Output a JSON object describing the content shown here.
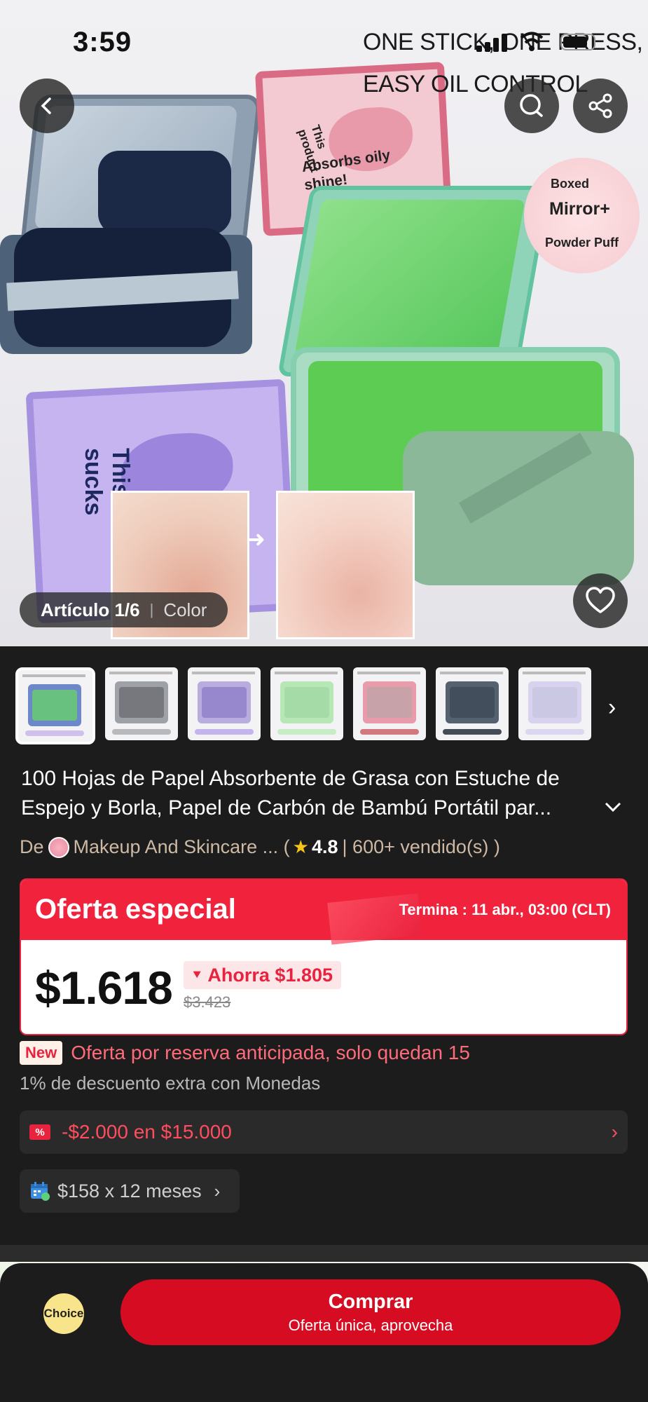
{
  "status_bar": {
    "time": "3:59"
  },
  "hero": {
    "banner_line1": "ONE STICK, ONE PRESS,",
    "banner_line2": "EASY OIL CONTROL",
    "pink_box_text": "Absorbs oily shine!",
    "pink_box_small": "This product",
    "purple_box_text": "This stuff sucks",
    "badge_line1": "Boxed",
    "badge_line2": "Mirror+",
    "badge_line3": "Powder Puff",
    "article_label": "Artículo 1/6",
    "color_label": "Color"
  },
  "icons": {
    "back": "back-arrow-icon",
    "search": "search-icon",
    "share": "share-icon",
    "favorite": "heart-icon",
    "next": "chevron-right-icon",
    "expand": "chevron-down-icon",
    "installments": "calendar-icon"
  },
  "thumbnails": [
    {
      "tone1": "#6d88c9",
      "tone2": "#67cf6c",
      "bar": "#d0c0ec",
      "active": true
    },
    {
      "tone1": "#9ea1a6",
      "tone2": "#6b6e73",
      "bar": "#b7b9bd",
      "active": false
    },
    {
      "tone1": "#b9acdf",
      "tone2": "#8f7fc9",
      "bar": "#c3b5ec",
      "active": false
    },
    {
      "tone1": "#b8e7b6",
      "tone2": "#9fd8a4",
      "bar": "#c8ecc5",
      "active": false
    },
    {
      "tone1": "#e79bab",
      "tone2": "#bfa4a8",
      "bar": "#d2787f",
      "active": false
    },
    {
      "tone1": "#55616f",
      "tone2": "#3e4a57",
      "bar": "#444d57",
      "active": false
    },
    {
      "tone1": "#d8d2ee",
      "tone2": "#c8c6e0",
      "bar": "#dcd7f0",
      "active": false
    }
  ],
  "product": {
    "title_line1": "100 Hojas de Papel Absorbente de Grasa con Estuche de",
    "title_line2": "Espejo y Borla, Papel de Carbón de Bambú Portátil par...",
    "seller_prefix": "De",
    "seller_name": "Makeup And Skincare ... (",
    "rating": "4.8",
    "sold": "| 600+ vendido(s) )"
  },
  "offer": {
    "title": "Oferta especial",
    "ends": "Termina : 11 abr., 03:00 (CLT)",
    "price": "$1.618",
    "savings": "Ahorra $1.805",
    "savings_icon": "⯆",
    "old_price": "$3.423"
  },
  "reserve": {
    "badge": "New",
    "text": "Oferta por reserva anticipada, solo quedan 15"
  },
  "coins_text": "1% de descuento extra con Monedas",
  "coupon": {
    "icon_text": "%",
    "text": "-$2.000 en $15.000",
    "chevron": "›"
  },
  "installments": {
    "text": "$158 x 12 meses",
    "chevron": "›"
  },
  "bottom_bar": {
    "choice_label": "Choice",
    "buy_label": "Comprar",
    "buy_sub": "Oferta única, aprovecha"
  },
  "colors": {
    "accent_red": "#f0223c",
    "buy_red": "#d60d22",
    "background": "#1c1c1c"
  }
}
